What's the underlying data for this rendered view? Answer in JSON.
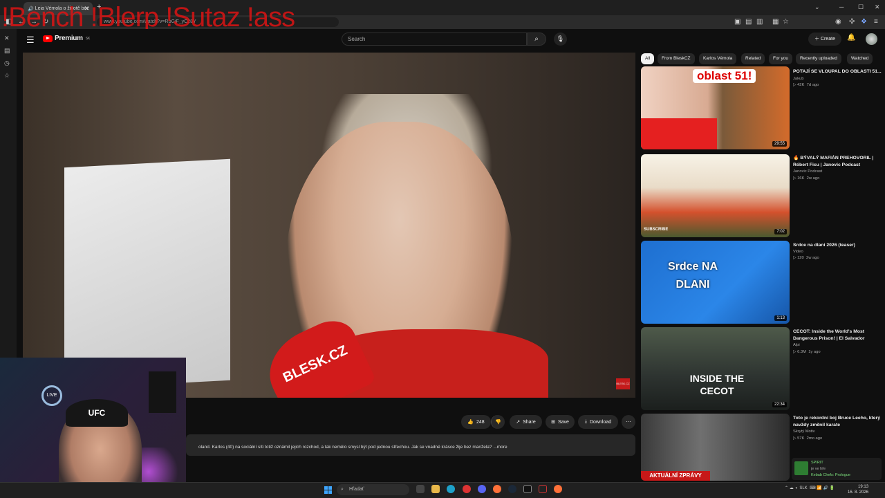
{
  "browser": {
    "tab_title": "Leia Vémola o životě bez",
    "new_tab": "+",
    "address": "www.youtube.com/watch?v=RbGjF_yC28Y",
    "overlay_text": "!Bench !Blerp !Sutaz !ass"
  },
  "header": {
    "logo_text": "Premium",
    "logo_region": "SK",
    "search_placeholder": "Search",
    "create_label": "Create"
  },
  "chips": [
    "All",
    "From BleskCZ",
    "Karlos Vémola",
    "Related",
    "For you",
    "Recently uploaded",
    "Watched"
  ],
  "video": {
    "mic_text": "BLESK.CZ",
    "watermark": "BLESK.CZ",
    "likes": "248",
    "share_label": "Share",
    "save_label": "Save",
    "download_label": "Download",
    "description": "oland. Karlos (40) na sociální síti totiž oznámil jejich rozchod, a tak nemělo smysl být pod jednou střechou. Jak se vnadné krásce žije bez manžela? ...more"
  },
  "webcam": {
    "cap_text": "UFC",
    "neon_text": "LIVE"
  },
  "recommendations": [
    {
      "title": "POTAJÍ SE VLOUPAL DO OBLASTI 51...",
      "channel": "Jakub",
      "views": "42K",
      "age": "7d ago",
      "duration": "29:55",
      "thumb_text": "oblast 51!"
    },
    {
      "title": "🔥 BÝVALÝ MAFIÁN PREHOVORIL | Róbert Ficu | Janovic Podcast",
      "channel": "Janovic Podcast",
      "views": "16K",
      "age": "2w ago",
      "duration": "7:02",
      "thumb_text": "SUBSCRIBE"
    },
    {
      "title": "Srdce na dlani 2026 (teaser)",
      "channel": "Video",
      "views": "120",
      "age": "2w ago",
      "duration": "1:13",
      "thumb_text": "Srdce NA DLANI"
    },
    {
      "title": "CECOT: Inside the World's Most Dangerous Prison! | El Salvador",
      "channel": "Alpi",
      "views": "6.3M",
      "age": "1y ago",
      "duration": "22:34",
      "thumb_text": "INSIDE THE CECOT"
    },
    {
      "title": "Toto je rekordní boj Bruce Leeho, který navždy změnil karate",
      "channel": "Skrytý Motiv",
      "views": "57K",
      "age": "2mo ago",
      "duration": "",
      "thumb_text": "AKTUÁLNÍ ZPRÁVY"
    }
  ],
  "taskbar": {
    "search_placeholder": "Hľadať",
    "language": "SLK",
    "time": "19:13",
    "date": "16. 8. 2026"
  },
  "notification": {
    "line1": "SPIRIT",
    "line2": "je ve hře",
    "line3": "Kebab Chefs: Prologue"
  },
  "colors": {
    "bg": "#0f0f0f",
    "accent_red": "#ff0000",
    "chip_bg": "#272727",
    "overlay_red": "#dc1414"
  }
}
